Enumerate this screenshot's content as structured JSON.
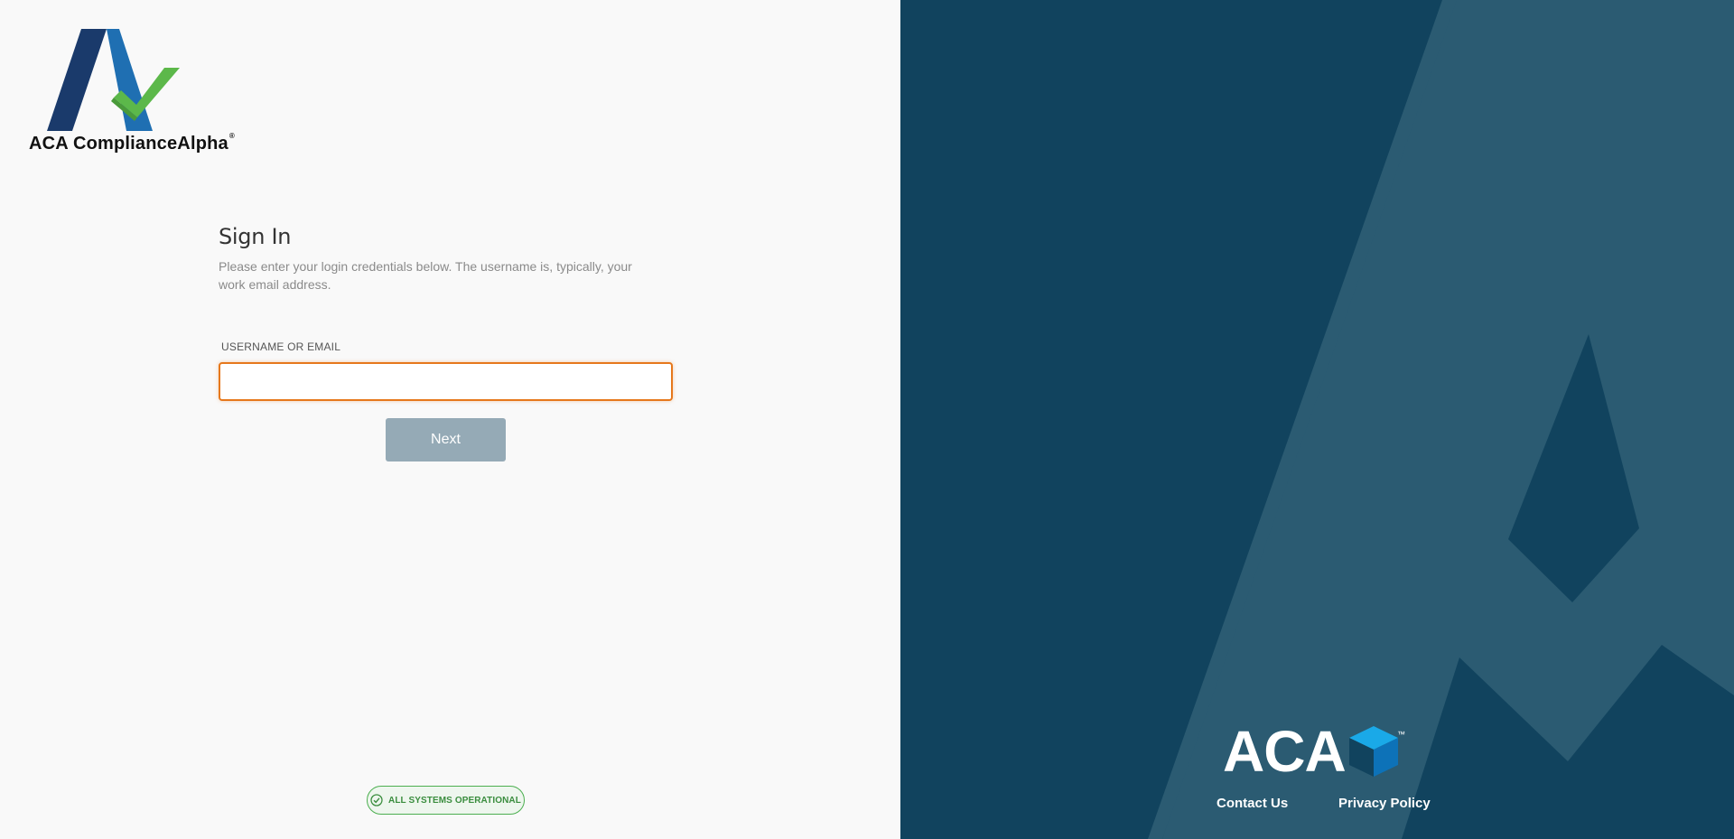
{
  "brand": {
    "product_name": "ACA ComplianceAlpha",
    "registered_mark": "®",
    "colors": {
      "navy": "#1a3a6b",
      "blue": "#1f6fb2",
      "green": "#5cb84a",
      "panel": "#11435e",
      "panel_shape": "#2b5b72",
      "accent_orange": "#e6781c"
    }
  },
  "signin": {
    "title": "Sign In",
    "subtitle": "Please enter your login credentials below. The username is, typically, your work email address.",
    "username_label": "USERNAME OR EMAIL",
    "username_value": "",
    "username_placeholder": "",
    "next_label": "Next"
  },
  "status": {
    "icon": "check-circle-icon",
    "text": "ALL SYSTEMS OPERATIONAL"
  },
  "aca": {
    "wordmark": "ACA",
    "trademark": "™"
  },
  "footer": {
    "contact_label": "Contact Us",
    "privacy_label": "Privacy Policy"
  }
}
